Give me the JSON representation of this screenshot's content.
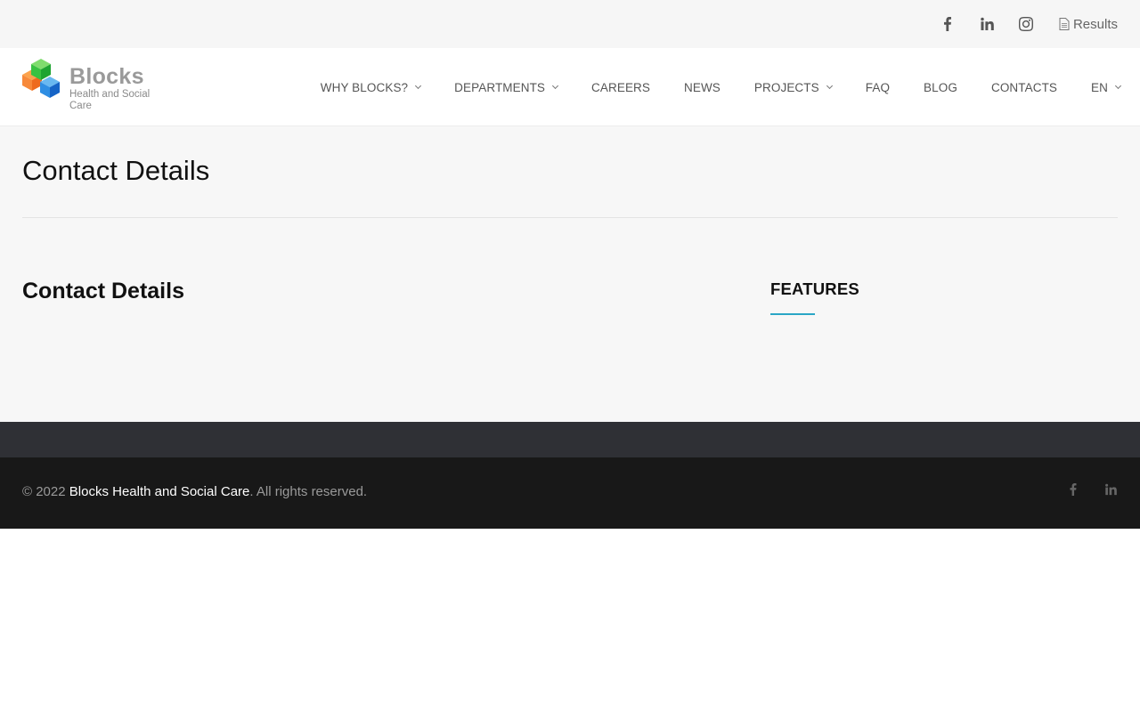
{
  "topbar": {
    "social": [
      {
        "icon": "facebook-icon"
      },
      {
        "icon": "linkedin-icon"
      },
      {
        "icon": "instagram-icon"
      }
    ],
    "results_label": "Results"
  },
  "logo": {
    "name": "Blocks",
    "subtitle": "Health and Social Care"
  },
  "nav": {
    "items": [
      {
        "label": "WHY BLOCKS?",
        "dropdown": true
      },
      {
        "label": "DEPARTMENTS",
        "dropdown": true
      },
      {
        "label": "CAREERS",
        "dropdown": false
      },
      {
        "label": "NEWS",
        "dropdown": false
      },
      {
        "label": "PROJECTS",
        "dropdown": true
      },
      {
        "label": "FAQ",
        "dropdown": false
      },
      {
        "label": "BLOG",
        "dropdown": false
      },
      {
        "label": "CONTACTS",
        "dropdown": false
      },
      {
        "label": "EN",
        "dropdown": true
      }
    ]
  },
  "main": {
    "page_title": "Contact Details",
    "content_title": "Contact Details",
    "sidebar_title": "FEATURES"
  },
  "footer": {
    "copyright_prefix": "© 2022 ",
    "brand": "Blocks Health and Social Care",
    "copyright_suffix": ". All rights reserved.",
    "social": [
      {
        "icon": "facebook-icon"
      },
      {
        "icon": "linkedin-icon"
      }
    ]
  },
  "colors": {
    "accent": "#2aa6c6",
    "footer_top": "#2f3035",
    "footer_bottom": "#181818",
    "topbar_bg": "#f6f6f6",
    "main_bg": "#f7f7f7"
  }
}
